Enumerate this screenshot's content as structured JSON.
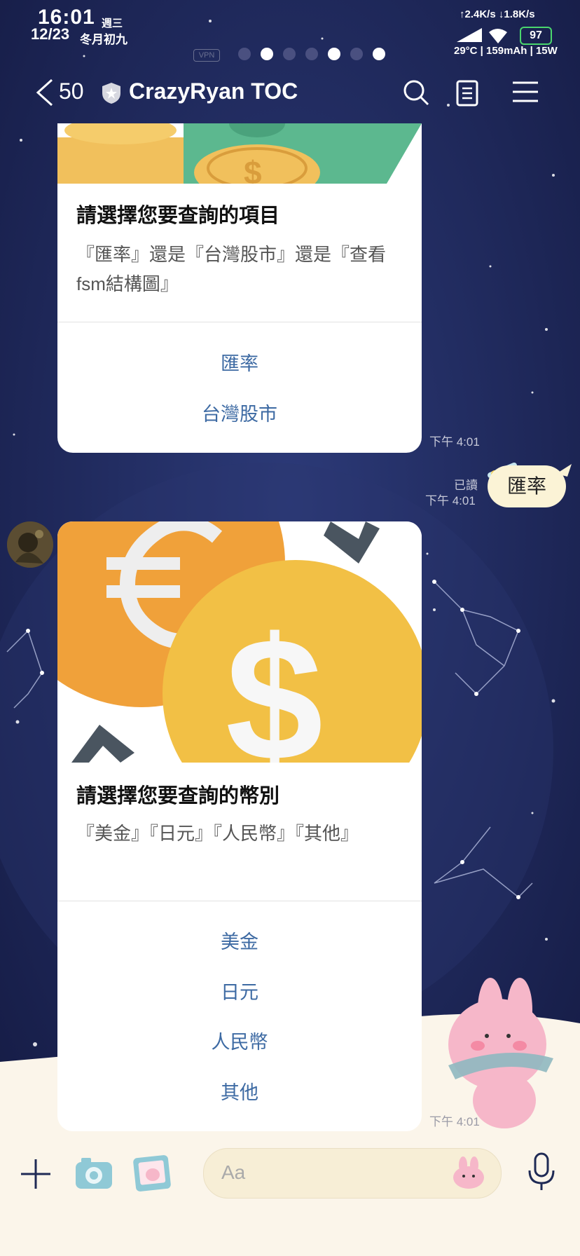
{
  "status_bar": {
    "time": "16:01",
    "weekday": "週三",
    "date": "12/23",
    "lunar_date": "冬月初九",
    "network_speed": "↑2.4K/s ↓1.8K/s",
    "battery_level": "97",
    "battery_info": "29°C | 159mAh | 15W",
    "vpn_label": "VPN"
  },
  "header": {
    "back_count": "50",
    "chat_title": "CrazyRyan TOC",
    "icons": [
      "back-chevron-icon",
      "shield-icon",
      "search-icon",
      "notes-icon",
      "menu-icon"
    ]
  },
  "messages": [
    {
      "type": "card",
      "title": "請選擇您要查詢的項目",
      "description": "『匯率』還是『台灣股市』還是『查看fsm結構圖』",
      "options": [
        "匯率",
        "台灣股市"
      ],
      "time": "下午 4:01"
    },
    {
      "type": "text",
      "sent": true,
      "text": "匯率",
      "read_label": "已讀",
      "time": "下午 4:01"
    },
    {
      "type": "card",
      "title": "請選擇您要查詢的幣別",
      "description": "『美金』『日元』『人民幣』『其他』",
      "options": [
        "美金",
        "日元",
        "人民幣",
        "其他"
      ],
      "time": "下午 4:01"
    }
  ],
  "input_bar": {
    "placeholder": "Aa",
    "icons": [
      "plus-icon",
      "camera-icon",
      "photo-icon",
      "sticker-icon",
      "microphone-icon"
    ]
  },
  "colors": {
    "accent_link": "#3d6aa3",
    "background_night": "#1c2454",
    "bubble": "#fbf3d6",
    "battery_green": "#4ad66d"
  }
}
